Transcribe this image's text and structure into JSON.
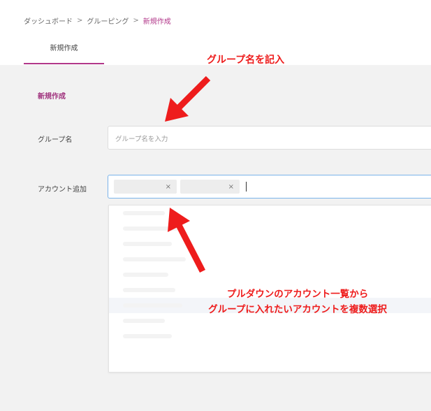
{
  "breadcrumb": {
    "items": [
      "ダッシュボード",
      "グルーピング",
      "新規作成"
    ],
    "separator": ">"
  },
  "tab": {
    "label": "新規作成"
  },
  "form": {
    "section_title": "新規作成",
    "group_label": "グループ名",
    "group_placeholder": "グループ名を入力",
    "account_label": "アカウント追加",
    "chip_remove": "×"
  },
  "annotations": {
    "group_name_note": "グループ名を記入",
    "dropdown_note_line1": "プルダウンのアカウント一覧から",
    "dropdown_note_line2": "グループに入れたいアカウントを複数選択"
  },
  "colors": {
    "accent": "#b2388a",
    "annotation": "#ee1c1c",
    "focus_border": "#7ab3ea"
  }
}
